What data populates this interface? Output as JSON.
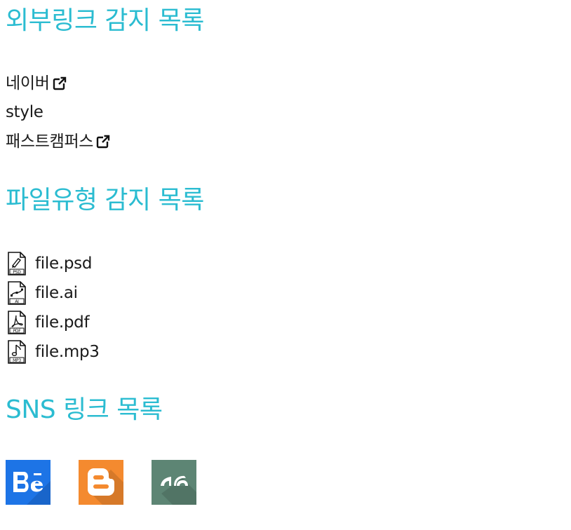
{
  "colors": {
    "heading": "#2bbcd1",
    "text": "#1a1a1a",
    "behance_bg": "#1d74e6",
    "blogger_bg": "#f48a2f",
    "deviantart_bg": "#5d8574"
  },
  "sections": {
    "external": {
      "title": "외부링크 감지 목록",
      "items": [
        {
          "label": "네이버",
          "external": true,
          "icon": "external-link-icon"
        },
        {
          "label": "style",
          "external": false
        },
        {
          "label": "패스트캠퍼스",
          "external": true,
          "icon": "external-link-icon"
        }
      ]
    },
    "filetype": {
      "title": "파일유형 감지 목록",
      "items": [
        {
          "label": "file.psd",
          "icon": "psd-file-icon",
          "badge": "PSD"
        },
        {
          "label": "file.ai",
          "icon": "ai-file-icon",
          "badge": "AI"
        },
        {
          "label": "file.pdf",
          "icon": "pdf-file-icon",
          "badge": "PDF"
        },
        {
          "label": "file.mp3",
          "icon": "mp3-file-icon",
          "badge": "MP3"
        }
      ]
    },
    "sns": {
      "title": "SNS 링크 목록",
      "items": [
        {
          "name": "Behance",
          "icon": "behance-icon"
        },
        {
          "name": "Blogger",
          "icon": "blogger-icon"
        },
        {
          "name": "DeviantArt",
          "icon": "deviantart-icon"
        }
      ]
    }
  }
}
